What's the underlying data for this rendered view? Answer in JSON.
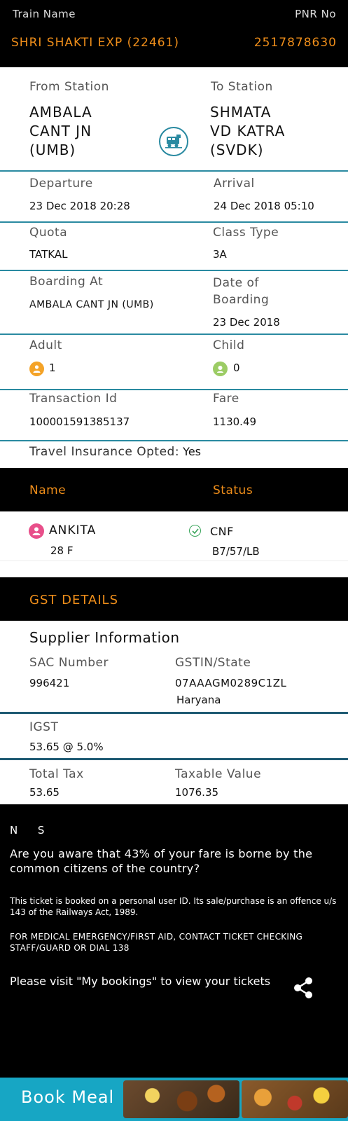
{
  "header": {
    "train_name_label": "Train Name",
    "pnr_label": "PNR No",
    "train_name": "SHRI SHAKTI EXP (22461)",
    "pnr": "2517878630"
  },
  "journey": {
    "from_label": "From Station",
    "to_label": "To Station",
    "from_station": "AMBALA\nCANT JN\n(UMB)",
    "to_station": "SHMATA\nVD KATRA\n(SVDK)",
    "departure_label": "Departure",
    "departure": "23 Dec 2018  20:28",
    "arrival_label": "Arrival",
    "arrival": "24 Dec 2018  05:10",
    "quota_label": "Quota",
    "quota": "TATKAL",
    "class_label": "Class Type",
    "class": "3A",
    "boarding_label": "Boarding At",
    "boarding": "AMBALA CANT JN (UMB)",
    "date_boarding_label": "Date of\nBoarding",
    "date_boarding": "23 Dec 2018",
    "adult_label": "Adult",
    "adult_count": "1",
    "child_label": "Child",
    "child_count": "0",
    "txn_label": "Transaction Id",
    "txn": "100001591385137",
    "fare_label": "Fare",
    "fare": "1130.49",
    "insurance_label": "Travel Insurance Opted:",
    "insurance": "Yes"
  },
  "passengers": {
    "name_header": "Name",
    "status_header": "Status",
    "list": [
      {
        "name": "ANKITA",
        "age_gender": "28 F",
        "status": "CNF",
        "berth": "B7/57/LB"
      }
    ]
  },
  "gst": {
    "title": "GST DETAILS",
    "supplier_title": "Supplier Information",
    "sac_label": "SAC Number",
    "sac": "996421",
    "gstin_label": "GSTIN/State",
    "gstin": "07AAAGM0289C1ZL",
    "state": "Haryana",
    "igst_label": "IGST",
    "igst": "53.65 @ 5.0%",
    "total_tax_label": "Total Tax",
    "total_tax": "53.65",
    "taxable_label": "Taxable Value",
    "taxable": "1076.35"
  },
  "footer": {
    "ns": "N      S",
    "aware": "Are you aware that 43% of your fare is borne by the common citizens of the country?",
    "personal_id": "This ticket is booked on a personal user ID. Its sale/purchase is an offence u/s 143 of the Railways Act, 1989.",
    "medical": "FOR MEDICAL EMERGENCY/FIRST AID, CONTACT TICKET CHECKING STAFF/GUARD OR DIAL 138",
    "visit": "Please visit \"My bookings\" to view your tickets"
  },
  "book_meal": {
    "label": "Book Meal"
  },
  "colors": {
    "accent_orange": "#ef8e1a",
    "teal": "#2a8aa1",
    "book_meal_bg": "#17a6c4"
  },
  "icons": [
    "train-icon",
    "adult-icon",
    "child-icon",
    "female-passenger-icon",
    "check-circle-icon",
    "share-icon"
  ]
}
